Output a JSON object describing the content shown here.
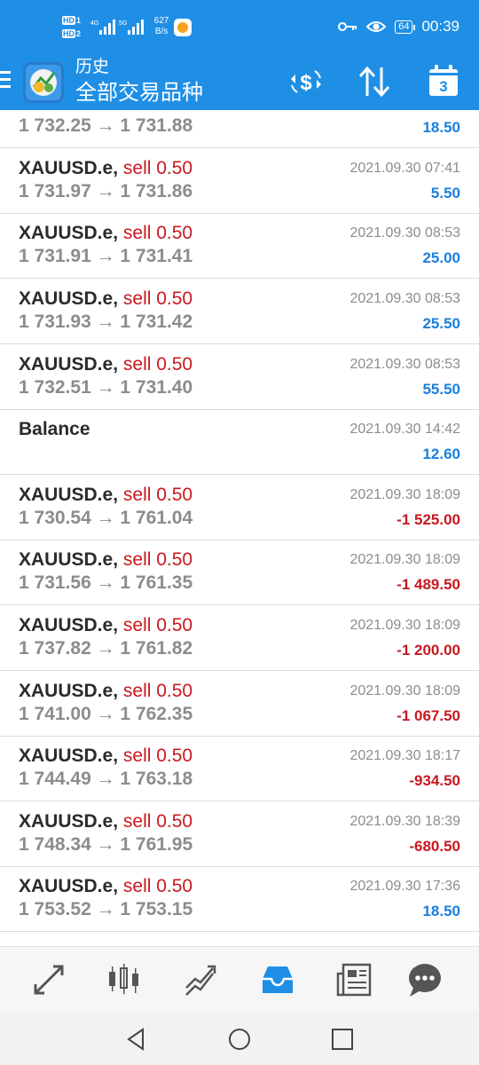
{
  "status_bar": {
    "hd1": "HD",
    "hd1_num": "1",
    "hd2": "HD",
    "hd2_num": "2",
    "net_speed_value": "627",
    "net_speed_unit": "B/s",
    "battery": "64",
    "time": "00:39"
  },
  "app_bar": {
    "subtitle": "历史",
    "title": "全部交易品种",
    "calendar_day": "3"
  },
  "deals": [
    {
      "type": "partial",
      "prices": "1 732.25 → 1 731.88",
      "profit": "18.50",
      "sign": "pos"
    },
    {
      "type": "trade",
      "symbol": "XAUUSD.e",
      "separator": ",",
      "action": "sell 0.50",
      "date": "2021.09.30 07:41",
      "prices": "1 731.97 → 1 731.86",
      "profit": "5.50",
      "sign": "pos"
    },
    {
      "type": "trade",
      "symbol": "XAUUSD.e",
      "separator": ",",
      "action": "sell 0.50",
      "date": "2021.09.30 08:53",
      "prices": "1 731.91 → 1 731.41",
      "profit": "25.00",
      "sign": "pos"
    },
    {
      "type": "trade",
      "symbol": "XAUUSD.e",
      "separator": ",",
      "action": "sell 0.50",
      "date": "2021.09.30 08:53",
      "prices": "1 731.93 → 1 731.42",
      "profit": "25.50",
      "sign": "pos"
    },
    {
      "type": "trade",
      "symbol": "XAUUSD.e",
      "separator": ",",
      "action": "sell 0.50",
      "date": "2021.09.30 08:53",
      "prices": "1 732.51 → 1 731.40",
      "profit": "55.50",
      "sign": "pos"
    },
    {
      "type": "balance",
      "symbol": "Balance",
      "date": "2021.09.30 14:42",
      "profit": "12.60",
      "sign": "pos"
    },
    {
      "type": "trade",
      "symbol": "XAUUSD.e",
      "separator": ",",
      "action": "sell 0.50",
      "date": "2021.09.30 18:09",
      "prices": "1 730.54 → 1 761.04",
      "profit": "-1 525.00",
      "sign": "neg"
    },
    {
      "type": "trade",
      "symbol": "XAUUSD.e",
      "separator": ",",
      "action": "sell 0.50",
      "date": "2021.09.30 18:09",
      "prices": "1 731.56 → 1 761.35",
      "profit": "-1 489.50",
      "sign": "neg"
    },
    {
      "type": "trade",
      "symbol": "XAUUSD.e",
      "separator": ",",
      "action": "sell 0.50",
      "date": "2021.09.30 18:09",
      "prices": "1 737.82 → 1 761.82",
      "profit": "-1 200.00",
      "sign": "neg"
    },
    {
      "type": "trade",
      "symbol": "XAUUSD.e",
      "separator": ",",
      "action": "sell 0.50",
      "date": "2021.09.30 18:09",
      "prices": "1 741.00 → 1 762.35",
      "profit": "-1 067.50",
      "sign": "neg"
    },
    {
      "type": "trade",
      "symbol": "XAUUSD.e",
      "separator": ",",
      "action": "sell 0.50",
      "date": "2021.09.30 18:17",
      "prices": "1 744.49 → 1 763.18",
      "profit": "-934.50",
      "sign": "neg"
    },
    {
      "type": "trade",
      "symbol": "XAUUSD.e",
      "separator": ",",
      "action": "sell 0.50",
      "date": "2021.09.30 18:39",
      "prices": "1 748.34 → 1 761.95",
      "profit": "-680.50",
      "sign": "neg"
    },
    {
      "type": "trade",
      "symbol": "XAUUSD.e",
      "separator": ",",
      "action": "sell 0.50",
      "date": "2021.09.30 17:36",
      "prices": "1 753.52 → 1 753.15",
      "profit": "18.50",
      "sign": "pos"
    }
  ],
  "bottom_nav": {
    "items": [
      {
        "icon": "quotes-icon"
      },
      {
        "icon": "candlestick-chart-icon"
      },
      {
        "icon": "trade-icon"
      },
      {
        "icon": "history-inbox-icon",
        "active": true
      },
      {
        "icon": "news-icon"
      },
      {
        "icon": "chat-icon"
      }
    ]
  },
  "colors": {
    "brand_blue": "#1f8fe6",
    "sell_red": "#c8181f",
    "profit_blue": "#1a7fde",
    "loss_red": "#c8181f",
    "nav_active": "#1f8fe6",
    "nav_inactive": "#555555"
  }
}
